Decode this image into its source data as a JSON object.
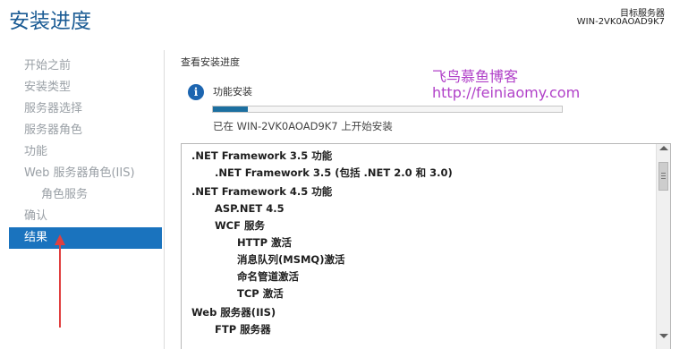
{
  "header": {
    "title": "安装进度",
    "server_label": "目标服务器",
    "server_name": "WIN-2VK0AOAD9K7"
  },
  "sidebar": {
    "items": [
      {
        "label": "开始之前"
      },
      {
        "label": "安装类型"
      },
      {
        "label": "服务器选择"
      },
      {
        "label": "服务器角色"
      },
      {
        "label": "功能"
      },
      {
        "label": "Web 服务器角色(IIS)"
      },
      {
        "label": "角色服务"
      },
      {
        "label": "确认"
      },
      {
        "label": "结果"
      }
    ],
    "active_index": 8
  },
  "main": {
    "section_title": "查看安装进度",
    "feature_label": "功能安装",
    "progress_fraction": 0.1,
    "status_text": "已在 WIN-2VK0AOAD9K7 上开始安装",
    "results": [
      ".NET Framework 3.5 功能",
      ".NET Framework 3.5 (包括 .NET 2.0 和 3.0)",
      ".NET Framework 4.5 功能",
      "ASP.NET 4.5",
      "WCF 服务",
      "HTTP 激活",
      "消息队列(MSMQ)激活",
      "命名管道激活",
      "TCP 激活",
      "Web 服务器(IIS)",
      "FTP 服务器"
    ]
  },
  "watermark": {
    "line1": "飞鸟慕鱼博客",
    "line2": "http://feiniaomy.com",
    "color": "#b040c8"
  },
  "colors": {
    "accent": "#1a73be",
    "title": "#1a5b94",
    "annotation_arrow": "#e04040"
  },
  "icons": {
    "info": "info-icon"
  }
}
